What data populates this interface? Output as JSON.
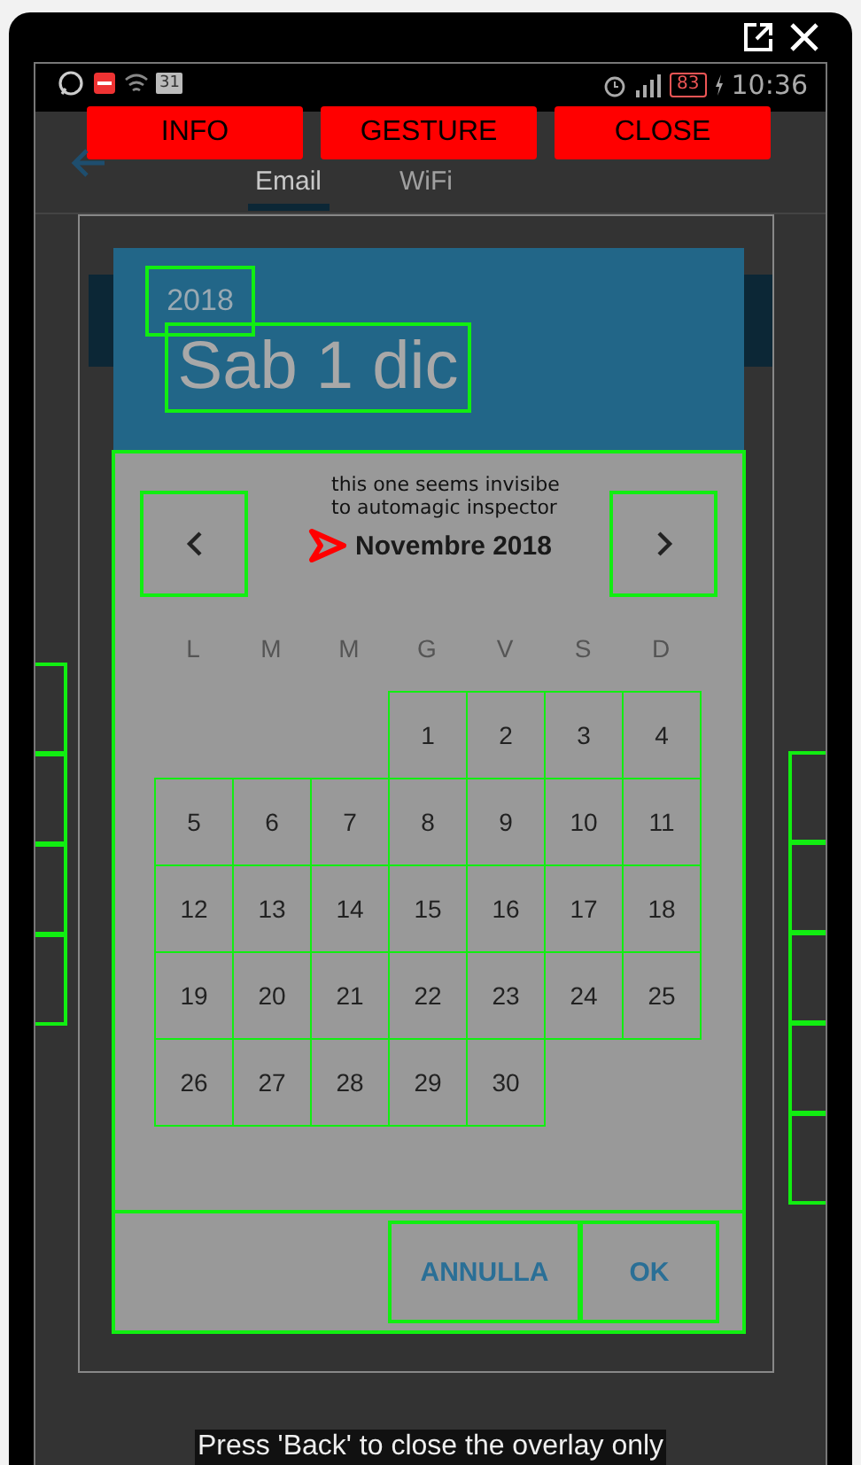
{
  "status_bar": {
    "calendar_icon": "31",
    "battery": "83",
    "time": "10:36"
  },
  "overlay_buttons": [
    "INFO",
    "GESTURE",
    "CLOSE"
  ],
  "app_bar": {
    "tabs": [
      {
        "label": "Email",
        "selected": true
      },
      {
        "label": "WiFi",
        "selected": false
      }
    ]
  },
  "date_picker": {
    "year": "2018",
    "date": "Sab 1 dic",
    "month": "Novembre 2018",
    "weekdays": [
      "L",
      "M",
      "M",
      "G",
      "V",
      "S",
      "D"
    ],
    "weeks": [
      [
        "1",
        "2",
        "3",
        "4"
      ],
      [
        "5",
        "6",
        "7",
        "8",
        "9",
        "10",
        "11"
      ],
      [
        "12",
        "13",
        "14",
        "15",
        "16",
        "17",
        "18"
      ],
      [
        "19",
        "20",
        "21",
        "22",
        "23",
        "24",
        "25"
      ],
      [
        "26",
        "27",
        "28",
        "29",
        "30"
      ]
    ],
    "buttons": [
      "ANNULLA",
      "OK"
    ]
  },
  "annotation": "this one seems invisibe to automagic inspector",
  "hint": "Press 'Back' to close the overlay only"
}
